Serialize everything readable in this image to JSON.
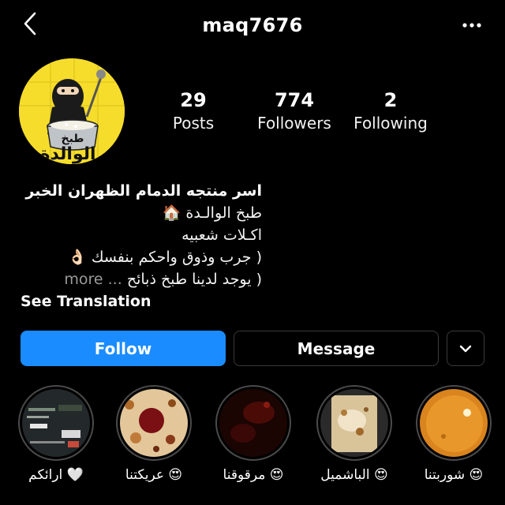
{
  "header": {
    "username": "maq7676",
    "back_icon": "chevron-left-icon",
    "more_icon": "more-horizontal-icon"
  },
  "profile": {
    "avatar_text_top": "طبخ",
    "avatar_text_bottom": "الوالدة",
    "avatar_bg": "#f6dd2b",
    "stats": [
      {
        "value": "29",
        "label": "Posts"
      },
      {
        "value": "774",
        "label": "Followers"
      },
      {
        "value": "2",
        "label": "Following"
      }
    ]
  },
  "bio": {
    "name": "اسر منتجه الدمام الظهران الخبر",
    "lines": [
      "طبخ الوالـدة 🏠",
      "اكـلات شعبيه",
      "( جرب وذوق واحكم بنفسك 👌🏻",
      "( يوجد لدينا طبخ ذبائح"
    ],
    "more_label": "... more",
    "see_translation": "See Translation"
  },
  "actions": {
    "follow_label": "Follow",
    "message_label": "Message",
    "follow_color": "#1a8cff"
  },
  "highlights": [
    {
      "label": "🤍 ارائكم"
    },
    {
      "label": "😍 عريكتنا"
    },
    {
      "label": "😍 مرقوقنا"
    },
    {
      "label": "😍 الباشميل"
    },
    {
      "label": "😍 شوربتنا"
    }
  ]
}
